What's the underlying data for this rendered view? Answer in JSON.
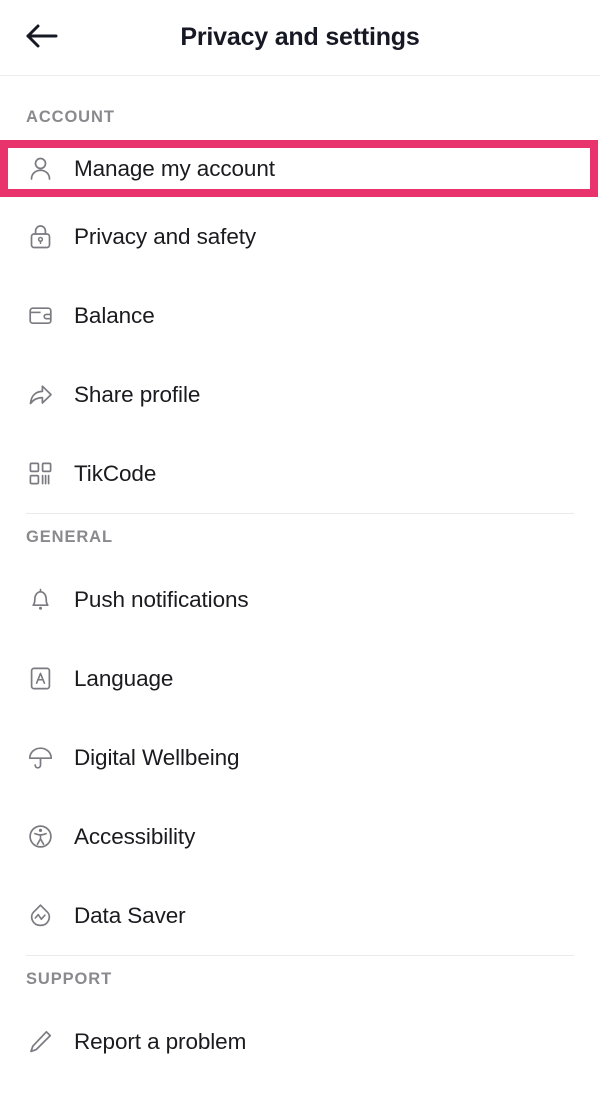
{
  "header": {
    "title": "Privacy and settings",
    "back_icon": "arrow-left-icon"
  },
  "sections": [
    {
      "label": "ACCOUNT",
      "items": [
        {
          "label": "Manage my account",
          "icon": "person-icon",
          "highlighted": true
        },
        {
          "label": "Privacy and safety",
          "icon": "lock-icon"
        },
        {
          "label": "Balance",
          "icon": "wallet-icon"
        },
        {
          "label": "Share profile",
          "icon": "share-arrow-icon"
        },
        {
          "label": "TikCode",
          "icon": "qr-code-icon"
        }
      ]
    },
    {
      "label": "GENERAL",
      "items": [
        {
          "label": "Push notifications",
          "icon": "bell-icon"
        },
        {
          "label": "Language",
          "icon": "letter-a-box-icon"
        },
        {
          "label": "Digital Wellbeing",
          "icon": "umbrella-icon"
        },
        {
          "label": "Accessibility",
          "icon": "accessibility-icon"
        },
        {
          "label": "Data Saver",
          "icon": "data-saver-droplet-icon"
        }
      ]
    },
    {
      "label": "SUPPORT",
      "items": [
        {
          "label": "Report a problem",
          "icon": "pencil-icon"
        }
      ]
    }
  ],
  "colors": {
    "highlight": "#e8336d",
    "text_primary": "#1b1b1f",
    "text_secondary": "#8a8a8e",
    "icon_stroke": "#7a7a80",
    "divider": "#e9e9e9"
  }
}
